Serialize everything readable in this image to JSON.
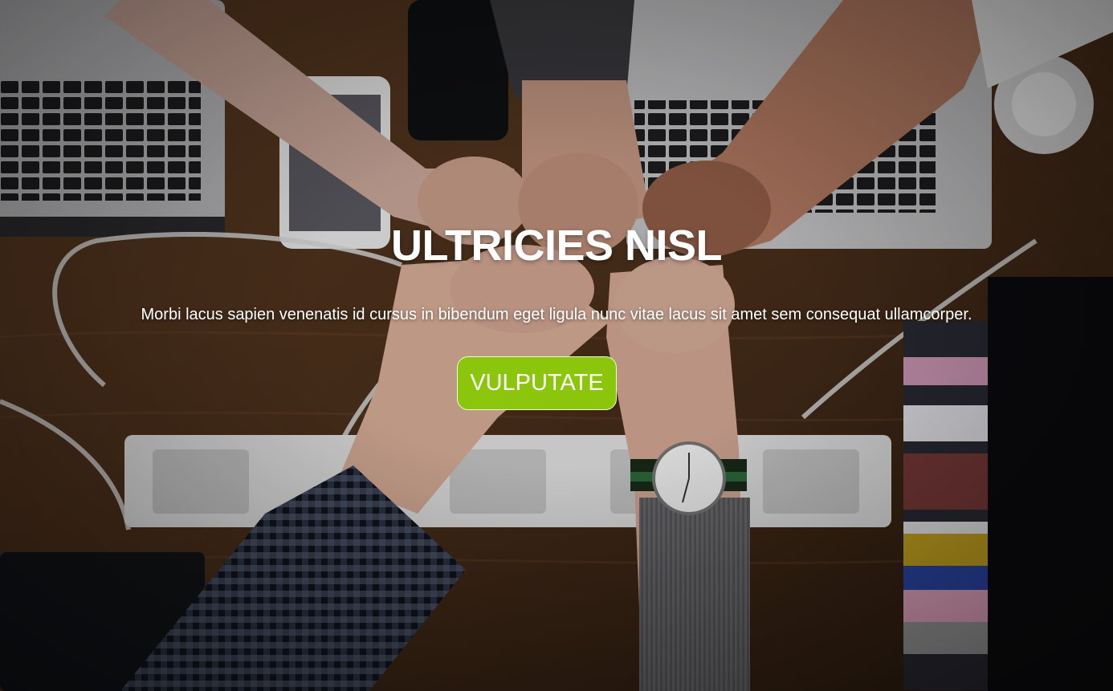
{
  "hero": {
    "title": "ULTRICIES NISL",
    "subtitle": "Morbi lacus sapien venenatis id cursus in bibendum eget ligula nunc vitae lacus sit amet sem consequat ullamcorper.",
    "cta_label": "VULPUTATE",
    "background_image": "team-fist-bump-over-desk",
    "colors": {
      "cta_background": "#8bc60d",
      "text": "#ffffff"
    }
  }
}
